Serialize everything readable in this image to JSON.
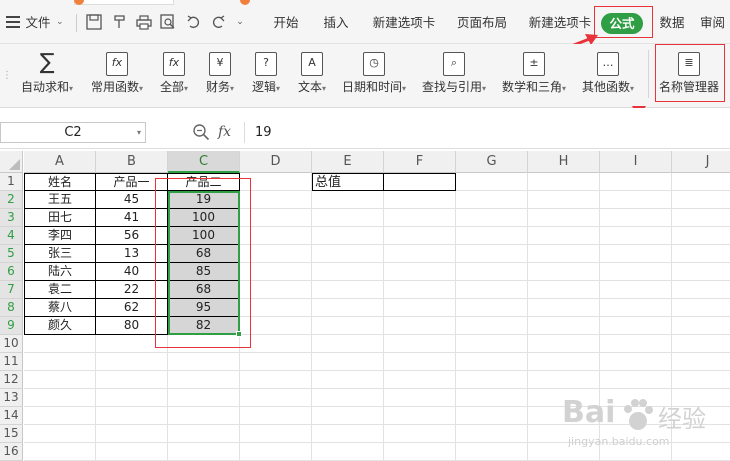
{
  "menubar": {
    "file_label": "文件",
    "tabs": [
      "开始",
      "插入",
      "新建选项卡",
      "页面布局",
      "新建选项卡",
      "公式",
      "数据",
      "审阅"
    ],
    "active_tab_index": 5,
    "accent_color": "#2f9e44"
  },
  "ribbon": {
    "buttons": [
      {
        "label": "自动求和",
        "icon": "sum-icon",
        "glyph": "∑"
      },
      {
        "label": "常用函数",
        "icon": "common-function-icon",
        "glyph": "fx"
      },
      {
        "label": "全部",
        "icon": "all-functions-icon",
        "glyph": "fx"
      },
      {
        "label": "财务",
        "icon": "finance-icon",
        "glyph": "¥"
      },
      {
        "label": "逻辑",
        "icon": "logic-icon",
        "glyph": "?"
      },
      {
        "label": "文本",
        "icon": "text-icon",
        "glyph": "A"
      },
      {
        "label": "日期和时间",
        "icon": "clock-icon",
        "glyph": "◷"
      },
      {
        "label": "查找与引用",
        "icon": "lookup-icon",
        "glyph": "⌕"
      },
      {
        "label": "数学和三角",
        "icon": "math-icon",
        "glyph": "±"
      },
      {
        "label": "其他函数",
        "icon": "more-functions-icon",
        "glyph": "…"
      },
      {
        "label": "名称管理器",
        "icon": "name-manager-icon",
        "glyph": "≣"
      }
    ]
  },
  "formula_bar": {
    "name_box": "C2",
    "zoom_icon": "zoom-icon",
    "fx_label": "fx",
    "value": "19"
  },
  "sheet": {
    "columns": [
      "A",
      "B",
      "C",
      "D",
      "E",
      "F",
      "G",
      "H",
      "I",
      "J"
    ],
    "selected_column": "C",
    "rows": [
      "1",
      "2",
      "3",
      "4",
      "5",
      "6",
      "7",
      "8",
      "9",
      "10",
      "11",
      "12",
      "13",
      "14",
      "15",
      "16"
    ],
    "selected_rows": [
      2,
      3,
      4,
      5,
      6,
      7,
      8,
      9
    ],
    "header": [
      "姓名",
      "产品一",
      "产品二"
    ],
    "data": [
      [
        "王五",
        "45",
        "19"
      ],
      [
        "田七",
        "41",
        "100"
      ],
      [
        "李四",
        "56",
        "100"
      ],
      [
        "张三",
        "13",
        "68"
      ],
      [
        "陆六",
        "40",
        "85"
      ],
      [
        "袁二",
        "22",
        "68"
      ],
      [
        "蔡八",
        "62",
        "95"
      ],
      [
        "颜久",
        "80",
        "82"
      ]
    ],
    "e1": "总值"
  },
  "watermark": {
    "brand": "Bai",
    "brand2": "经验",
    "url": "jingyan.baidu.com"
  }
}
